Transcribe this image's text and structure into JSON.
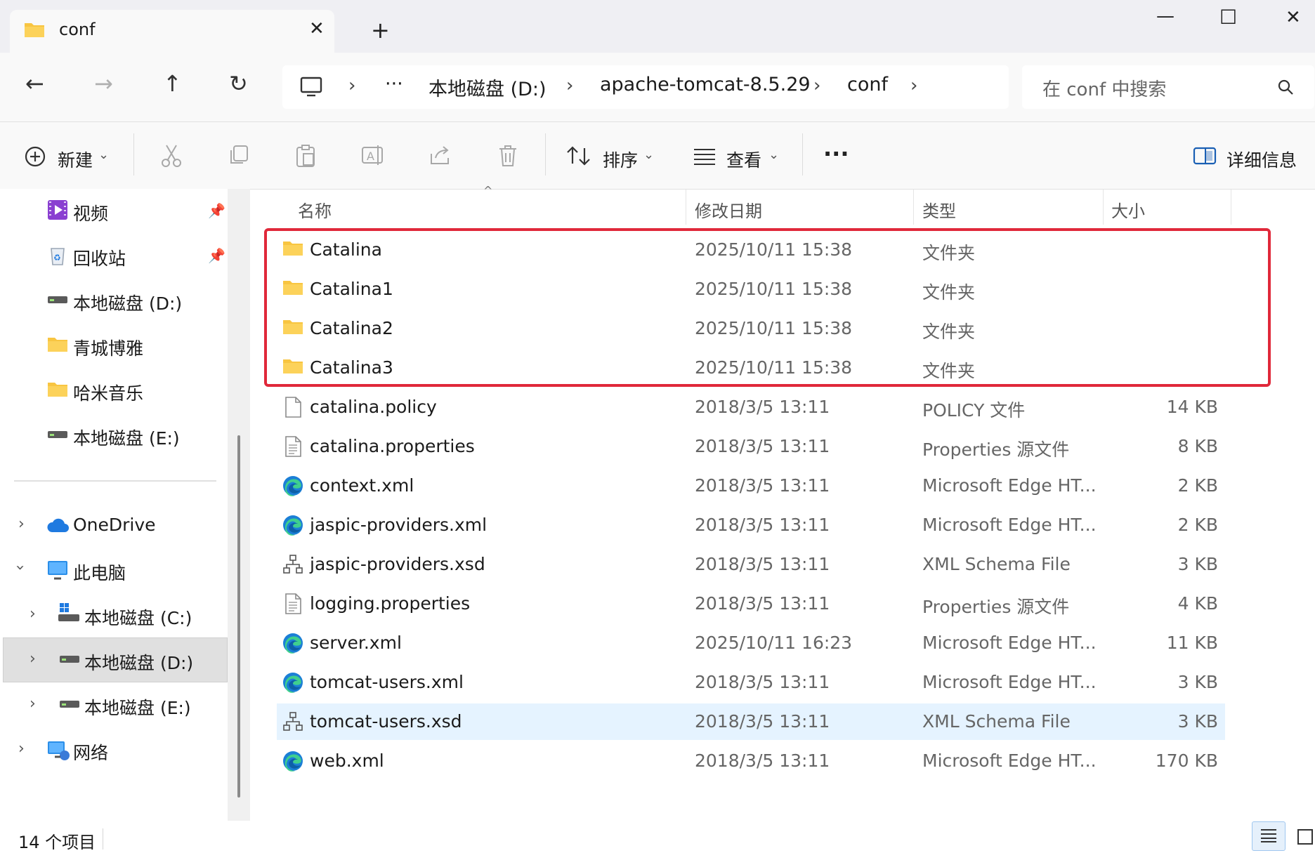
{
  "window": {
    "tab_title": "conf",
    "new_tab": "+",
    "minimize": "—",
    "maximize": "☐",
    "close": "✕"
  },
  "nav": {
    "back": "←",
    "forward": "→",
    "up": "↑",
    "refresh": "↻"
  },
  "breadcrumb": {
    "more": "···",
    "items": [
      "本地磁盘 (D:)",
      "apache-tomcat-8.5.29",
      "conf"
    ],
    "sep": "›"
  },
  "search": {
    "placeholder": "在 conf 中搜索"
  },
  "toolbar": {
    "new_label": "新建",
    "sort_label": "排序",
    "view_label": "查看",
    "more": "···",
    "details_label": "详细信息"
  },
  "sidebar": {
    "quick": [
      {
        "label": "视频",
        "icon": "video-icon",
        "pinned": true
      },
      {
        "label": "回收站",
        "icon": "recycle-bin-icon",
        "pinned": true
      },
      {
        "label": "本地磁盘 (D:)",
        "icon": "drive-icon"
      },
      {
        "label": "青城博雅",
        "icon": "folder-icon"
      },
      {
        "label": "哈米音乐",
        "icon": "folder-icon"
      },
      {
        "label": "本地磁盘 (E:)",
        "icon": "drive-icon"
      }
    ],
    "tree": [
      {
        "label": "OneDrive",
        "icon": "cloud-icon",
        "expanded": false
      },
      {
        "label": "此电脑",
        "icon": "pc-icon",
        "expanded": true
      },
      {
        "label": "本地磁盘 (C:)",
        "icon": "windows-drive-icon"
      },
      {
        "label": "本地磁盘 (D:)",
        "icon": "drive-icon",
        "selected": true
      },
      {
        "label": "本地磁盘 (E:)",
        "icon": "drive-icon"
      },
      {
        "label": "网络",
        "icon": "network-icon"
      }
    ]
  },
  "columns": {
    "name": "名称",
    "date": "修改日期",
    "type": "类型",
    "size": "大小"
  },
  "files": [
    {
      "name": "Catalina",
      "date": "2025/10/11 15:38",
      "type": "文件夹",
      "size": "",
      "icon": "folder-icon"
    },
    {
      "name": "Catalina1",
      "date": "2025/10/11 15:38",
      "type": "文件夹",
      "size": "",
      "icon": "folder-icon"
    },
    {
      "name": "Catalina2",
      "date": "2025/10/11 15:38",
      "type": "文件夹",
      "size": "",
      "icon": "folder-icon"
    },
    {
      "name": "Catalina3",
      "date": "2025/10/11 15:38",
      "type": "文件夹",
      "size": "",
      "icon": "folder-icon"
    },
    {
      "name": "catalina.policy",
      "date": "2018/3/5 13:11",
      "type": "POLICY 文件",
      "size": "14 KB",
      "icon": "file-icon"
    },
    {
      "name": "catalina.properties",
      "date": "2018/3/5 13:11",
      "type": "Properties 源文件",
      "size": "8 KB",
      "icon": "text-file-icon"
    },
    {
      "name": "context.xml",
      "date": "2018/3/5 13:11",
      "type": "Microsoft Edge HT...",
      "size": "2 KB",
      "icon": "edge-icon"
    },
    {
      "name": "jaspic-providers.xml",
      "date": "2018/3/5 13:11",
      "type": "Microsoft Edge HT...",
      "size": "2 KB",
      "icon": "edge-icon"
    },
    {
      "name": "jaspic-providers.xsd",
      "date": "2018/3/5 13:11",
      "type": "XML Schema File",
      "size": "3 KB",
      "icon": "schema-icon"
    },
    {
      "name": "logging.properties",
      "date": "2018/3/5 13:11",
      "type": "Properties 源文件",
      "size": "4 KB",
      "icon": "text-file-icon"
    },
    {
      "name": "server.xml",
      "date": "2025/10/11 16:23",
      "type": "Microsoft Edge HT...",
      "size": "11 KB",
      "icon": "edge-icon"
    },
    {
      "name": "tomcat-users.xml",
      "date": "2018/3/5 13:11",
      "type": "Microsoft Edge HT...",
      "size": "3 KB",
      "icon": "edge-icon"
    },
    {
      "name": "tomcat-users.xsd",
      "date": "2018/3/5 13:11",
      "type": "XML Schema File",
      "size": "3 KB",
      "icon": "schema-icon",
      "hover": true
    },
    {
      "name": "web.xml",
      "date": "2018/3/5 13:11",
      "type": "Microsoft Edge HT...",
      "size": "170 KB",
      "icon": "edge-icon"
    }
  ],
  "status": {
    "count": "14 个项目"
  },
  "colors": {
    "highlight_box": "#e0283a",
    "hover_row": "#e5f3ff",
    "selected_nav": "#e0e0e0"
  }
}
